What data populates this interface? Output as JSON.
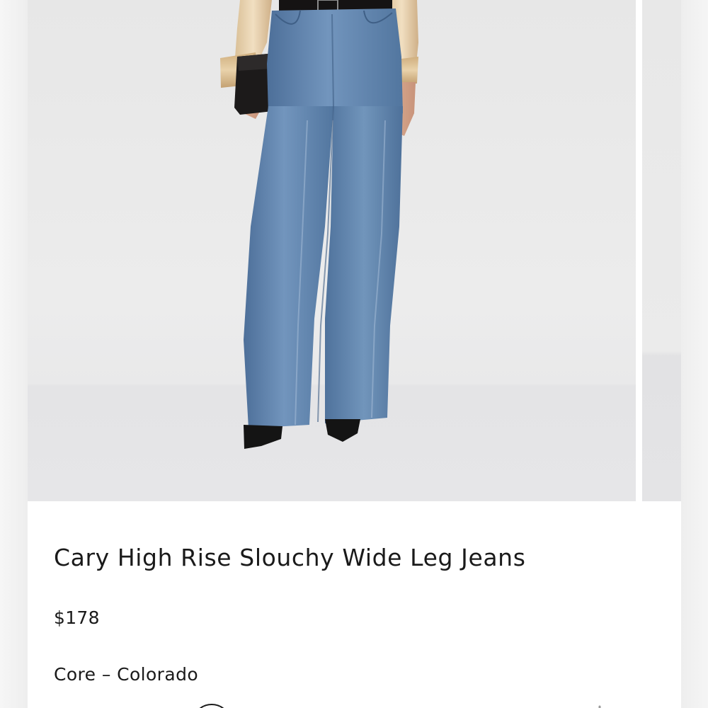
{
  "product": {
    "title": "Cary High Rise Slouchy Wide Leg Jeans",
    "price": "$178",
    "fit": "Core",
    "separator": "–",
    "wash": "Colorado"
  },
  "carousel": {
    "current_slide": 1,
    "image_description": "Model wearing medium-wash wide leg jeans with black belt, satin blouse, black clutch and black pointed boots"
  },
  "colors": {
    "background": "#ededed",
    "panel": "#ffffff",
    "text": "#1a1a1a",
    "denim": "#5b7fa8"
  },
  "icons": [
    "selected-color-swatch-icon",
    "loading-spinner-icon"
  ]
}
